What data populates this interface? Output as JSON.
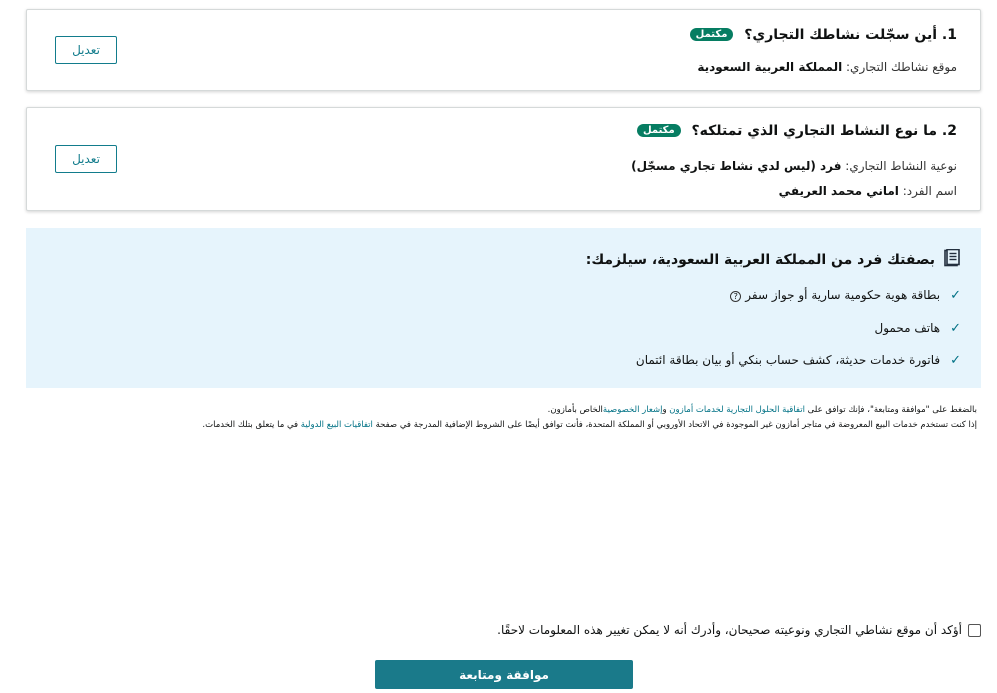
{
  "colors": {
    "accent": "#127c8c",
    "badge_bg": "#067d62",
    "link": "#007185",
    "info_bg": "#e6f4fc",
    "submit_bg": "#1a7a8a"
  },
  "section1": {
    "title": "1. أين سجّلت نشاطك التجاري؟",
    "badge": "مكتمل",
    "line1_label": "موقع نشاطك التجاري: ",
    "line1_value": "المملكة العربية السعودية",
    "edit_label": "تعديل"
  },
  "section2": {
    "title": "2. ما نوع النشاط التجاري الذي تمتلكه؟",
    "badge": "مكتمل",
    "line1_label": "نوعية النشاط التجاري: ",
    "line1_value": "فرد (ليس لدي نشاط تجاري مسجّل)",
    "line2_label": "اسم الفرد: ",
    "line2_value": "اماني محمد العريفي",
    "edit_label": "تعديل"
  },
  "requirements": {
    "icon": "document-icon",
    "title": "بصفتك فرد من المملكة العربية السعودية، سيلزمك:",
    "items": [
      "بطاقة هوية حكومية سارية أو جواز سفر",
      "هاتف محمول",
      "فاتورة خدمات حديثة، كشف حساب بنكي أو بيان بطاقة ائتمان"
    ]
  },
  "terms": {
    "line1_a": "بالضغط على \"موافقة ومتابعة\"، فإنك توافق على ",
    "link_agreement": "اتفاقية الحلول التجارية لخدمات أمازون",
    "and": " و",
    "link_privacy": "إشعار الخصوصية",
    "line1_b": "الخاص بأمازون.",
    "line2_a": "إذا كنت تستخدم خدمات البيع المعروضة في متاجر أمازون غير الموجودة في الاتحاد الأوروبي أو المملكة المتحدة، فأنت توافق أيضًا على الشروط الإضافية المدرجة في صفحة ",
    "link_intl": "اتفاقيات البيع الدولية",
    "line2_b": " في ما يتعلق بتلك الخدمات."
  },
  "confirm_text": "أؤكد أن موقع نشاطي التجاري ونوعيته صحيحان، وأدرك أنه لا يمكن تغيير هذه المعلومات لاحقًا.",
  "submit_label": "موافقة ومتابعة"
}
